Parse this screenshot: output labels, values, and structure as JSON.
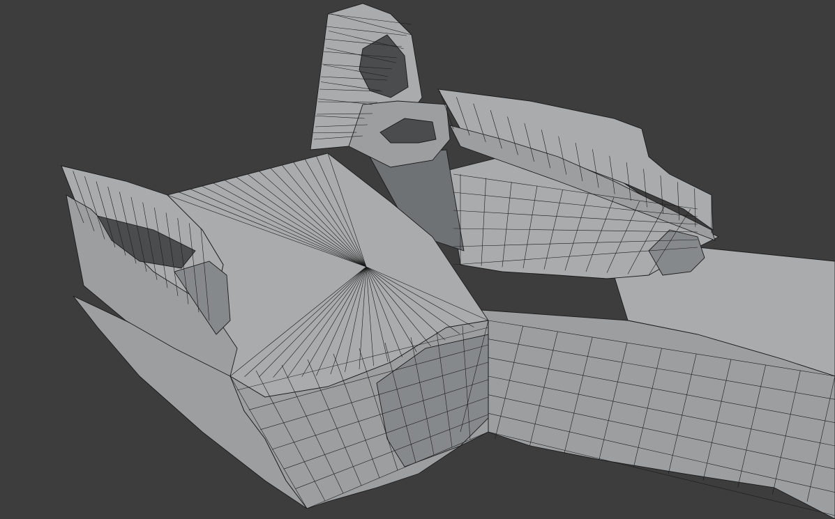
{
  "viewport": {
    "background": "#3d3d3d",
    "mesh_color": "#a9abac",
    "wire_color": "#1a1a1a",
    "shading": "solid",
    "overlay": "wireframe"
  }
}
